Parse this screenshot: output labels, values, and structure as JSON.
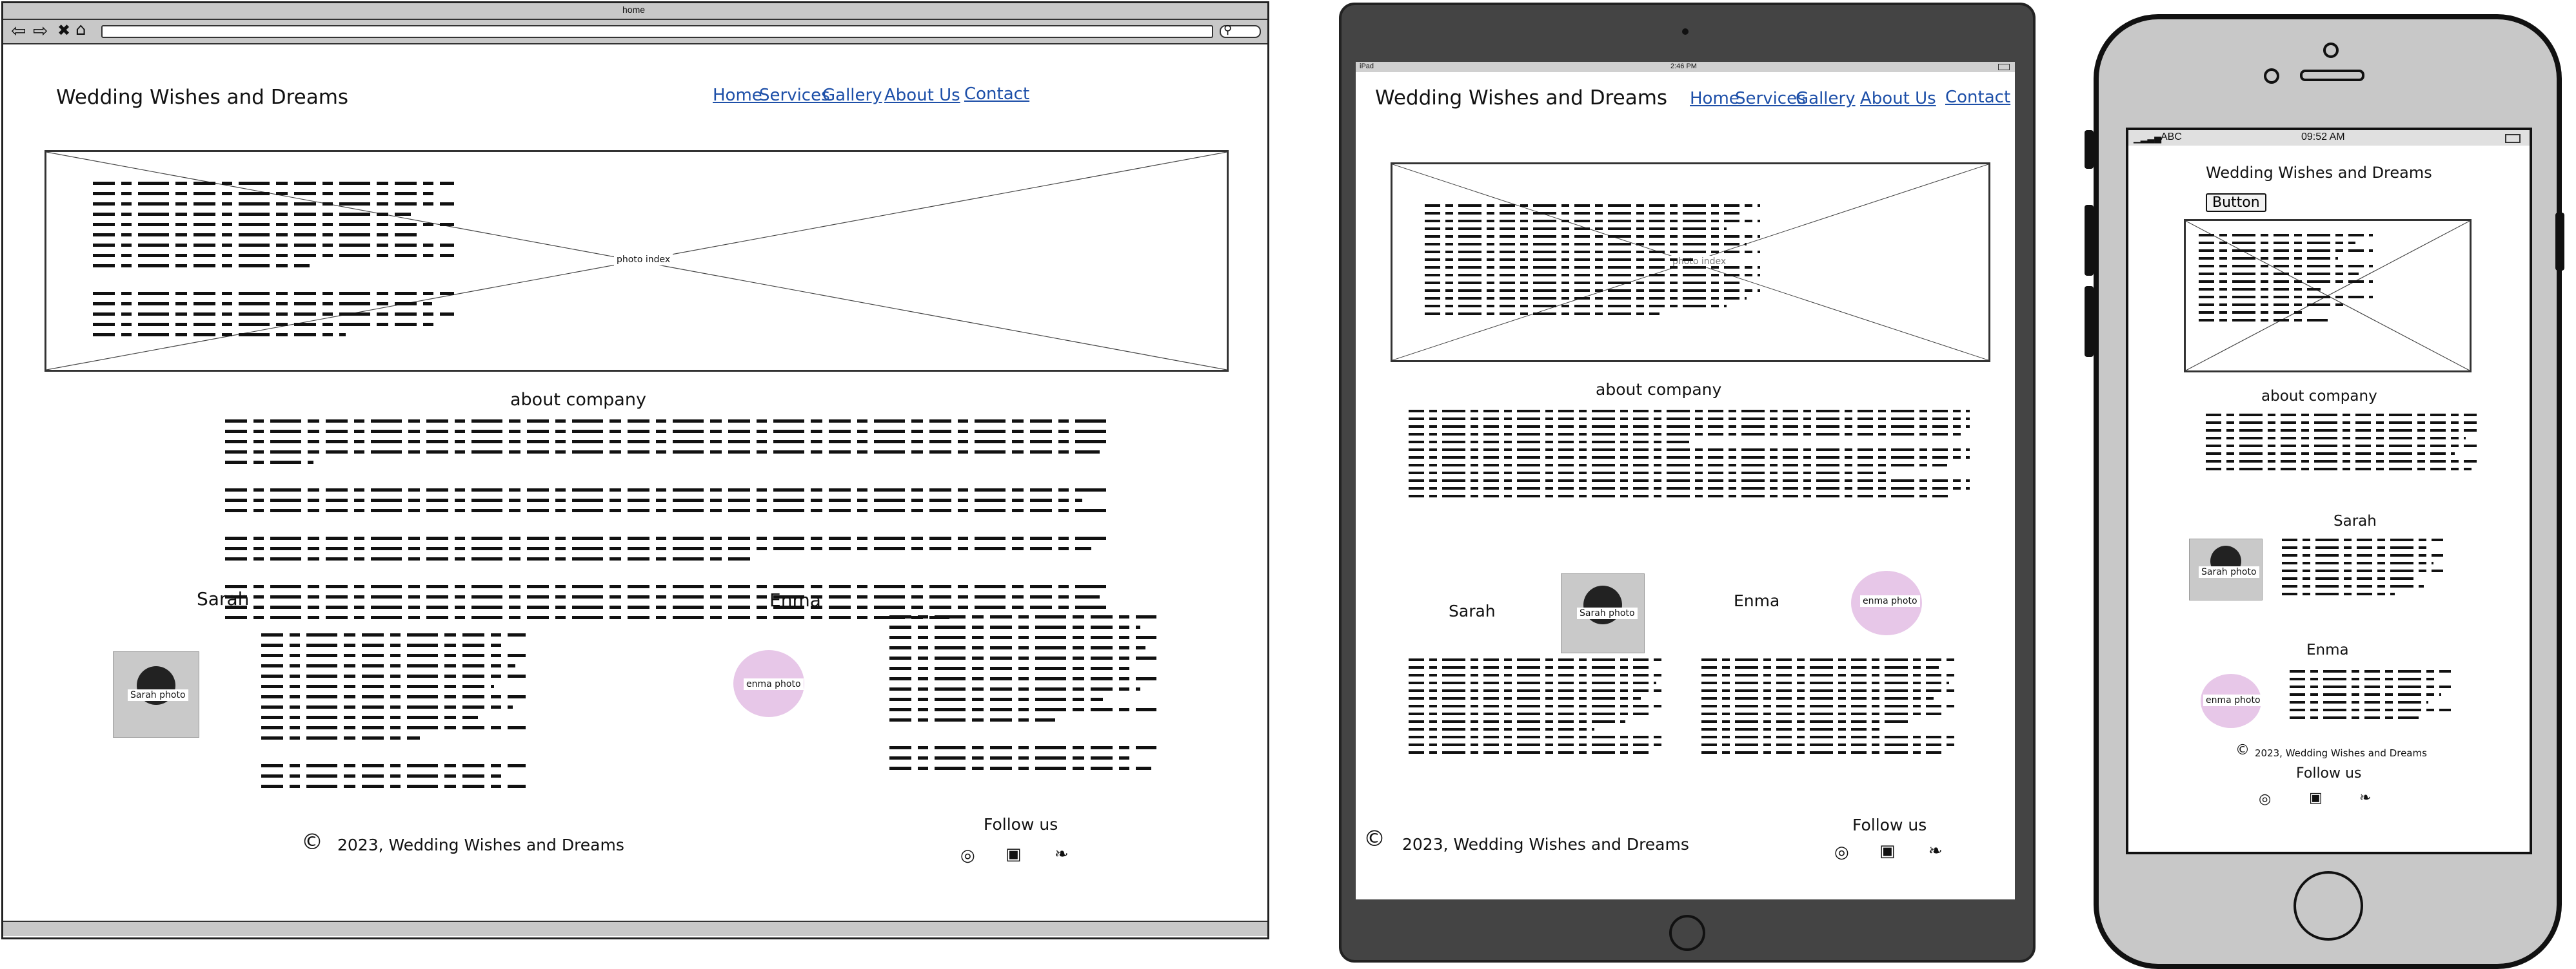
{
  "desktop": {
    "browser_title": "home",
    "site_title": "Wedding Wishes and Dreams",
    "nav": [
      "Home",
      "Services",
      "Gallery",
      "About Us",
      "Contact"
    ],
    "hero_caption": "photo index",
    "about_heading": "about company",
    "team": [
      {
        "name": "Sarah",
        "photo_caption": "Sarah photo"
      },
      {
        "name": "Enma",
        "photo_caption": "enma photo"
      }
    ],
    "footer": {
      "copyright_symbol": "©",
      "copyright": "2023, Wedding Wishes and Dreams",
      "follow": "Follow us"
    }
  },
  "tablet": {
    "status_left": "iPad",
    "status_time": "2:46 PM",
    "site_title": "Wedding Wishes and Dreams",
    "nav": [
      "Home",
      "Services",
      "Gallery",
      "About Us",
      "Contact"
    ],
    "hero_caption": "photo index",
    "about_heading": "about company",
    "team": [
      {
        "name": "Sarah",
        "photo_caption": "Sarah photo"
      },
      {
        "name": "Enma",
        "photo_caption": "enma photo"
      }
    ],
    "footer": {
      "copyright_symbol": "©",
      "copyright": "2023, Wedding Wishes and Dreams",
      "follow": "Follow us"
    }
  },
  "phone": {
    "carrier": "ABC",
    "time": "09:52 AM",
    "site_title": "Wedding Wishes and Dreams",
    "button": "Button",
    "about_heading": "about company",
    "team": [
      {
        "name": "Sarah",
        "photo_caption": "Sarah photo"
      },
      {
        "name": "Enma",
        "photo_caption": "enma photo"
      }
    ],
    "footer": {
      "copyright_symbol": "©",
      "copyright": "2023, Wedding Wishes and Dreams",
      "follow": "Follow us"
    }
  },
  "icons": [
    "instagram-icon",
    "facebook-icon",
    "twitter-icon"
  ],
  "colors": {
    "link": "#1d4fa8",
    "device_frame": "#444444",
    "phone_body": "#c8c8c8",
    "browser_chrome": "#c8c8c8"
  }
}
